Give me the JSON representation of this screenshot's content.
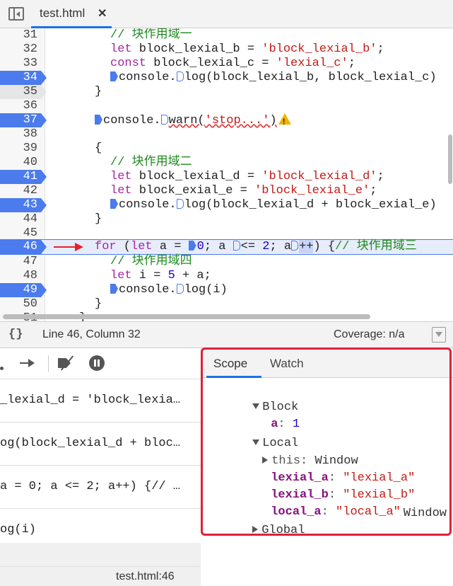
{
  "tab": {
    "label": "test.html",
    "close": "✕"
  },
  "editor": {
    "lines": [
      {
        "num": "31",
        "bp": ""
      },
      {
        "num": "32",
        "bp": ""
      },
      {
        "num": "33",
        "bp": ""
      },
      {
        "num": "34",
        "bp": "active"
      },
      {
        "num": "35",
        "bp": "disabled"
      },
      {
        "num": "36",
        "bp": ""
      },
      {
        "num": "37",
        "bp": "active"
      },
      {
        "num": "38",
        "bp": ""
      },
      {
        "num": "39",
        "bp": ""
      },
      {
        "num": "40",
        "bp": ""
      },
      {
        "num": "41",
        "bp": "active"
      },
      {
        "num": "42",
        "bp": ""
      },
      {
        "num": "43",
        "bp": "active"
      },
      {
        "num": "44",
        "bp": ""
      },
      {
        "num": "45",
        "bp": ""
      },
      {
        "num": "46",
        "bp": "active"
      },
      {
        "num": "47",
        "bp": ""
      },
      {
        "num": "48",
        "bp": ""
      },
      {
        "num": "49",
        "bp": "active"
      },
      {
        "num": "50",
        "bp": ""
      },
      {
        "num": "51",
        "bp": ""
      }
    ],
    "code": {
      "l31": "// 块作用域一",
      "l32_kw": "let",
      "l32_id": " block_lexial_b = ",
      "l32_str": "'block_lexial_b'",
      "l32_end": ";",
      "l33_kw": "const",
      "l33_id": " block_lexial_c = ",
      "l33_str": "'lexial_c'",
      "l33_end": ";",
      "l34_a": "console.",
      "l34_b": "log(block_lexial_b, block_lexial_c)",
      "l35": "}",
      "l37_a": "console.",
      "l37_b": "warn(",
      "l37_str": "'stop...'",
      "l37_c": ")",
      "l39": "{",
      "l40": "// 块作用域二",
      "l41_kw": "let",
      "l41_id": " block_lexial_d = ",
      "l41_str": "'block_lexial_d'",
      "l41_end": ";",
      "l42_kw": "let",
      "l42_id": " block_exial_e = ",
      "l42_str": "'block_lexial_e'",
      "l42_end": ";",
      "l43_a": "console.",
      "l43_b": "log(block_lexial_d + block_exial_e)",
      "l44": "}",
      "l46_kw1": "for",
      "l46_p1": " (",
      "l46_kw2": "let",
      "l46_p2": " a = ",
      "l46_n0": "0",
      "l46_p3": "; a ",
      "l46_p4": "<= ",
      "l46_n2": "2",
      "l46_p5": "; a",
      "l46_inc": "++",
      "l46_p6": ") {",
      "l46_cm": "// 块作用域三",
      "l47": "// 块作用域四",
      "l48_kw": "let",
      "l48_id": " i = ",
      "l48_n": "5",
      "l48_end": " + a;",
      "l49_a": "console.",
      "l49_b": "log(i)",
      "l50": "}",
      "l51": "}"
    }
  },
  "status": {
    "format_label": "{}",
    "cursor": "Line 46, Column 32",
    "coverage": "Coverage: n/a"
  },
  "callstack": {
    "items": [
      "_lexial_d = 'block_lexia…",
      "og(block_lexial_d + bloc…",
      "a = 0; a <= 2; a++) {// …",
      "og(i)"
    ],
    "footer": "test.html:46"
  },
  "scope": {
    "tabs": [
      "Scope",
      "Watch"
    ],
    "block_label": "Block",
    "block_var_name": "a",
    "block_var_value": "1",
    "local_label": "Local",
    "this_name": "this",
    "this_value": "Window",
    "vars": [
      {
        "name": "lexial_a",
        "value": "\"lexial_a\""
      },
      {
        "name": "lexial_b",
        "value": "\"lexial_b\""
      },
      {
        "name": "local_a",
        "value": "\"local_a\""
      }
    ],
    "global_label": "Global",
    "global_value": "Window"
  },
  "colors": {
    "breakpoint": "#4b7bec",
    "keyword": "#a626a4",
    "string": "#c41a16",
    "comment": "#1f8a1f",
    "highlight_border": "#e0203a"
  }
}
